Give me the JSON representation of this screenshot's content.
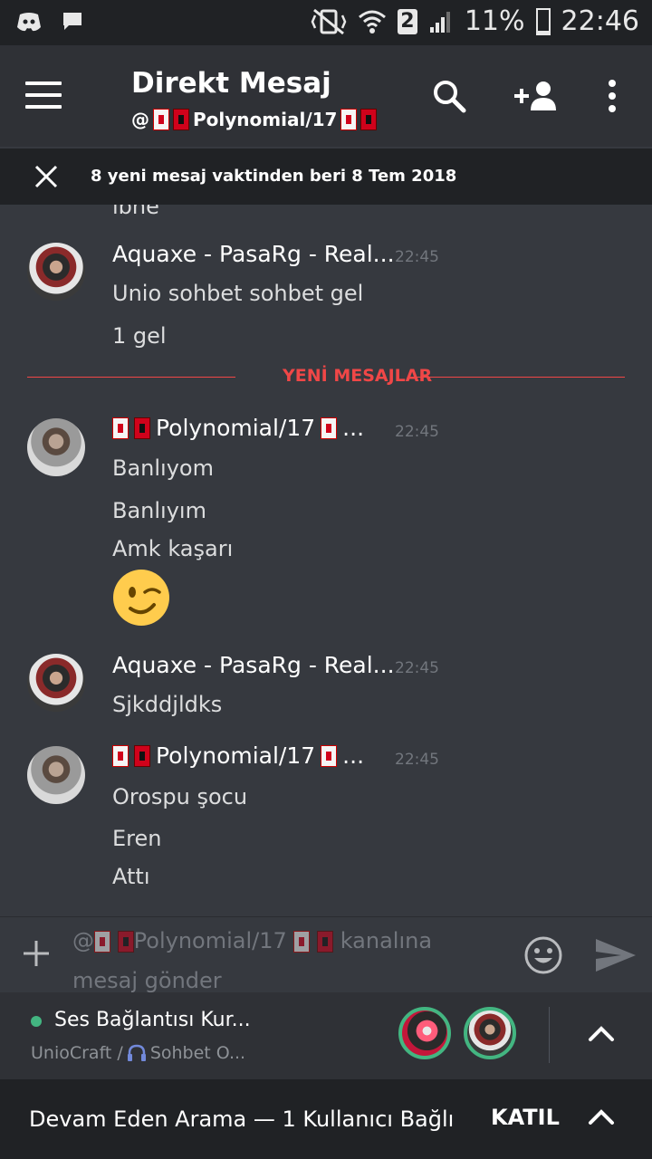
{
  "status_bar": {
    "sim": "2",
    "battery": "11%",
    "battery_level": 0.11,
    "time": "22:46",
    "icons": [
      "discord-icon",
      "chat-icon",
      "vibrate-icon",
      "wifi-icon",
      "signal-icon",
      "battery-icon"
    ]
  },
  "header": {
    "title": "Direkt Mesaj",
    "sub_prefix": "@",
    "sub_name": "Polynomial/17",
    "icons": [
      "menu-icon",
      "search-icon",
      "add-friend-icon",
      "more-icon"
    ]
  },
  "banner": {
    "text": "8 yeni mesaj vaktinden beri 8 Tem 2018"
  },
  "messages": {
    "partial_top": "ibne",
    "groups": [
      {
        "author": "Aquaxe - PasaRg - Real...",
        "time": "22:45",
        "lines": [
          "Unio sohbet sohbet gel",
          "1 gel"
        ]
      },
      {
        "author": "Polynomial/17",
        "author_tail": "...",
        "time": "22:45",
        "lines": [
          "Banlıyom",
          "Banlıyım",
          "Amk kaşarı"
        ],
        "emoji": "winking-face"
      },
      {
        "author": "Aquaxe - PasaRg - Real...",
        "time": "22:45",
        "lines": [
          "Sjkddjldks"
        ]
      },
      {
        "author": "Polynomial/17",
        "author_tail": "...",
        "time": "22:45",
        "lines": [
          "Orospu şocu",
          "Eren",
          "Attı"
        ]
      }
    ],
    "divider_label": "YENİ MESAJLAR"
  },
  "input": {
    "placeholder_prefix": "@",
    "placeholder_name": "Polynomial/17",
    "placeholder_suffix": "kanalına",
    "placeholder_line2": "mesaj gönder"
  },
  "voice": {
    "title": "Ses Bağlantısı Kur...",
    "server": "UnioCraft /",
    "channel": "Sohbet O..."
  },
  "call": {
    "text": "Devam Eden Arama — 1 Kullanıcı Bağlı",
    "join": "KATIL"
  },
  "colors": {
    "background": "#36393f",
    "header": "#2f3136",
    "dark": "#202225",
    "new_messages_red": "#f04747",
    "voice_green": "#43b581",
    "timestamp": "#72767d"
  }
}
